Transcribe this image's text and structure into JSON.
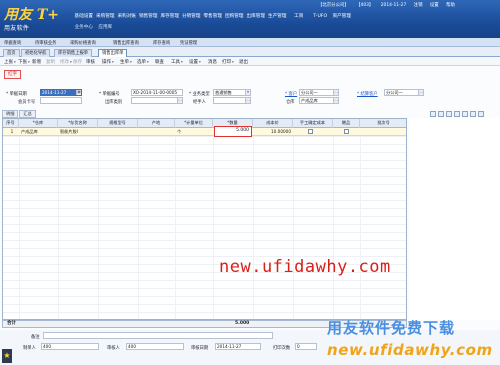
{
  "app": {
    "logo_text": "用友 T+",
    "logo_sub": "用友软件"
  },
  "topbar": {
    "items": [
      "【北京分公司】",
      "【403】",
      "2014-11-27",
      "注销",
      "设置",
      "帮助"
    ]
  },
  "menu": {
    "row1": [
      "基础设置",
      "采购管理",
      "采购对账",
      "销售管理",
      "库存管理",
      "分销管理",
      "零售管理",
      "团购管理",
      "出库管理",
      "生产管理",
      "工资",
      "T-UFO",
      "资产管理"
    ],
    "row2": [
      "业务中心",
      "应用库"
    ]
  },
  "breadcrumb": {
    "items": [
      "单据查询",
      "待审核业务",
      "采购价格查询",
      "销售出库查询",
      "库存查询",
      "凭证管理"
    ]
  },
  "tabs": [
    {
      "label": "首页",
      "active": false
    },
    {
      "label": "初始化导航",
      "active": false
    },
    {
      "label": "库存销售上报单",
      "active": false
    },
    {
      "label": "销售出库单",
      "active": true
    }
  ],
  "toolbar": {
    "items": [
      {
        "label": "上张",
        "caret": true,
        "disabled": false
      },
      {
        "label": "下张",
        "caret": true,
        "disabled": false
      },
      {
        "label": "新增",
        "caret": false,
        "disabled": false
      },
      {
        "label": "复制",
        "caret": false,
        "disabled": true
      },
      {
        "label": "修改",
        "caret": true,
        "disabled": true
      },
      {
        "label": "保存",
        "caret": false,
        "disabled": true
      },
      {
        "label": "审核",
        "caret": false,
        "disabled": false
      },
      {
        "label": "操作",
        "caret": true,
        "disabled": false
      },
      {
        "label": "生单",
        "caret": true,
        "disabled": false
      },
      {
        "label": "选单",
        "caret": true,
        "disabled": false
      },
      {
        "label": "联查",
        "caret": false,
        "disabled": false
      },
      {
        "label": "工具",
        "caret": true,
        "disabled": false
      },
      {
        "label": "设置",
        "caret": true,
        "disabled": false
      },
      {
        "label": "消息",
        "caret": false,
        "disabled": false
      },
      {
        "label": "打印",
        "caret": true,
        "disabled": false
      },
      {
        "label": "退出",
        "caret": false,
        "disabled": false
      }
    ]
  },
  "bill": {
    "badge": "红字",
    "fields": {
      "date_label": "* 单据日期",
      "date_value": "2014-11-27",
      "code_label": "* 单据编号",
      "code_value": "XO-2014-11-00-0005",
      "biztype_label": "* 业务类型",
      "biztype_value": "普通销售",
      "customer_label": "* 客户",
      "customer_value": "分公司一",
      "settle_label": "* 结算客户",
      "settle_value": "分公司一",
      "dept_label": "出库类别",
      "dept_value": "",
      "member_label": "会员卡号",
      "member_value": "",
      "handler_label": "经手人",
      "handler_value": "",
      "warehouse_label": "仓库",
      "warehouse_value": "产成品库"
    }
  },
  "gridtabs": [
    "明细",
    "汇总"
  ],
  "grid": {
    "columns": [
      "序号",
      "*仓库",
      "*存货名称",
      "规格型号",
      "产地",
      "*计量单位",
      "*数量",
      "成本价",
      "手工确定成本",
      "赠品",
      "批次号"
    ],
    "rows": [
      {
        "no": "1",
        "warehouse": "产成品库",
        "item": "智能片胶I",
        "spec": "",
        "origin": "",
        "unit": "个",
        "qty": "5.000",
        "cost": "10.00000",
        "manual": false,
        "gift": false,
        "batch": ""
      }
    ],
    "total_label": "合计",
    "total_qty": "5.000"
  },
  "footer": {
    "remark_label": "备注",
    "remark_value": "",
    "maker_label": "制单人",
    "maker_value": "400",
    "auditor_label": "审核人",
    "auditor_value": "400",
    "audit_date_label": "审核日期",
    "audit_date_value": "2014-11-27",
    "print_label": "打印次数",
    "print_value": "0"
  },
  "watermarks": {
    "line1": "new.ufidawhy.com",
    "line2": "用友软件免费下载",
    "line3": "new.ufidawhy.com"
  },
  "colors": {
    "header_bg": "#1a4c99",
    "logo_accent": "#ffd33b",
    "watermark_red": "#d8201a",
    "watermark_blue": "#4a8fe0",
    "watermark_orange": "#f0a419",
    "qty_highlight": "#e03131"
  }
}
